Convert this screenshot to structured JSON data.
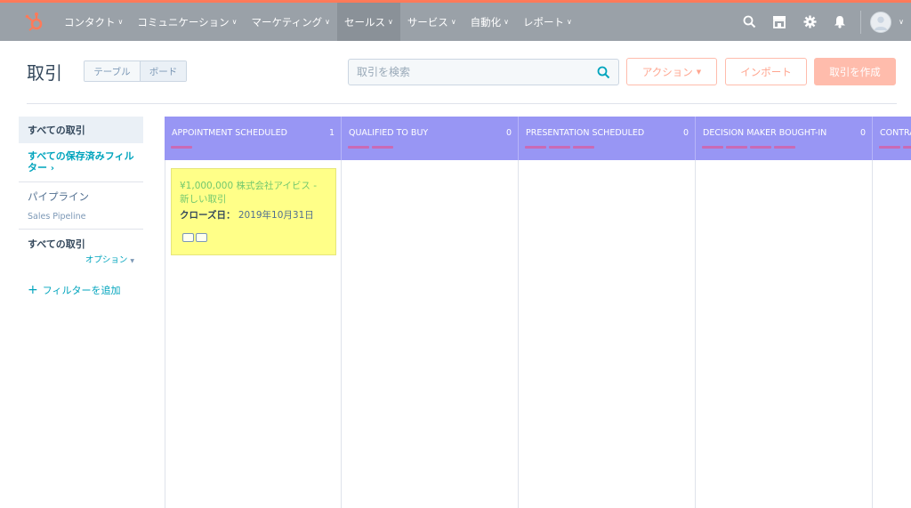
{
  "nav": {
    "items": [
      {
        "label": "コンタクト"
      },
      {
        "label": "コミュニケーション"
      },
      {
        "label": "マーケティング"
      },
      {
        "label": "セールス"
      },
      {
        "label": "サービス"
      },
      {
        "label": "自動化"
      },
      {
        "label": "レポート"
      }
    ],
    "active_index": 3,
    "icons": [
      "search-icon",
      "marketplace-icon",
      "settings-gear-icon",
      "notifications-bell-icon",
      "avatar"
    ]
  },
  "header": {
    "title": "取引",
    "view_options": [
      "テーブル",
      "ボード"
    ],
    "selected_view": "ボード",
    "search_placeholder": "取引を検索",
    "action_button": "アクション",
    "import_button": "インポート",
    "create_button": "取引を作成"
  },
  "sidebar": {
    "all_deals_selected": "すべての取引",
    "saved_filters_link": "すべての保存済みフィルター",
    "pipeline_label": "パイプライン",
    "pipeline_value": "Sales Pipeline",
    "filter_label": "すべての取引",
    "options_label": "オプション",
    "add_filter_label": "フィルターを追加"
  },
  "board": {
    "columns": [
      {
        "name": "APPOINTMENT SCHEDULED",
        "count": "1",
        "bars": 1
      },
      {
        "name": "QUALIFIED TO BUY",
        "count": "0",
        "bars": 2
      },
      {
        "name": "PRESENTATION SCHEDULED",
        "count": "0",
        "bars": 3
      },
      {
        "name": "DECISION MAKER BOUGHT-IN",
        "count": "0",
        "bars": 4
      },
      {
        "name": "CONTRA",
        "count": "",
        "bars": 4
      }
    ],
    "card": {
      "title": "¥1,000,000 株式会社アイビス - 新しい取引",
      "close_label": "クローズ日：",
      "close_value": "2019年10月31日"
    }
  },
  "colors": {
    "accent": "#ff7a59",
    "link": "#00a4bd",
    "stage_header": "#9896f4",
    "card_bg": "#ffff88"
  }
}
